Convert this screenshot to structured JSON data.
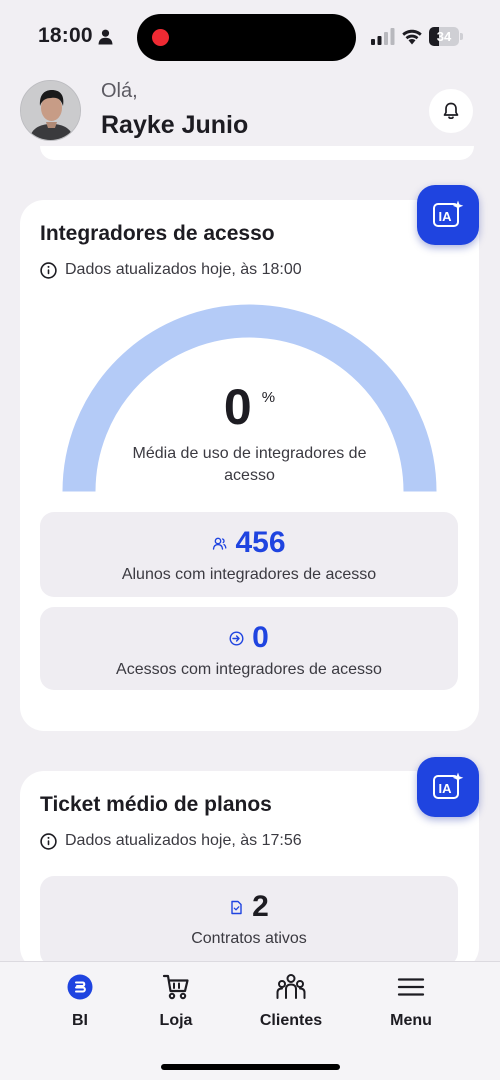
{
  "status_bar": {
    "time": "18:00",
    "battery_level": "34",
    "icons": [
      "person-icon",
      "signal-icon",
      "wifi-icon",
      "battery-icon"
    ]
  },
  "header": {
    "greeting": "Olá,",
    "user_name": "Rayke Junio",
    "icons": [
      "avatar",
      "bell-icon"
    ]
  },
  "integradores_card": {
    "title": "Integradores de acesso",
    "updated": "Dados atualizados hoje, às 18:00",
    "gauge": {
      "value": "0",
      "unit": "%",
      "percent": 0,
      "caption": "Média de uso de integradores de acesso",
      "color": "#b4cbf7"
    },
    "stats": [
      {
        "icon": "users-icon",
        "value": "456",
        "label": "Alunos com integradores de acesso"
      },
      {
        "icon": "login-icon",
        "value": "0",
        "label": "Acessos com integradores de acesso"
      }
    ],
    "ia_button_icon": "ia-sparkle-icon"
  },
  "ticket_card": {
    "title": "Ticket médio de planos",
    "updated": "Dados atualizados hoje, às 17:56",
    "stat": {
      "icon": "document-icon",
      "value": "2",
      "label": "Contratos ativos"
    },
    "ia_button_icon": "ia-sparkle-icon"
  },
  "bottom_nav": {
    "items": [
      {
        "label": "BI",
        "icon": "bi-icon",
        "active": true
      },
      {
        "label": "Loja",
        "icon": "cart-icon",
        "active": false
      },
      {
        "label": "Clientes",
        "icon": "people-icon",
        "active": false
      },
      {
        "label": "Menu",
        "icon": "hamburger-icon",
        "active": false
      }
    ]
  },
  "colors": {
    "accent": "#1f44e0",
    "gauge": "#b4cbf7",
    "background": "#f1eff3",
    "card": "#ffffff"
  }
}
